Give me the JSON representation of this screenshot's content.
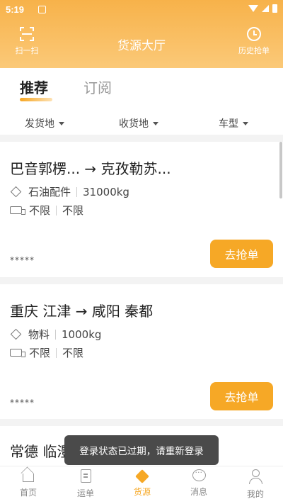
{
  "status_bar": {
    "time": "5:19"
  },
  "header": {
    "title": "货源大厅",
    "scan_label": "扫一扫",
    "history_label": "历史抢单"
  },
  "tabs": [
    {
      "label": "推荐",
      "active": true
    },
    {
      "label": "订阅",
      "active": false
    }
  ],
  "filters": [
    {
      "label": "发货地"
    },
    {
      "label": "收货地"
    },
    {
      "label": "车型"
    }
  ],
  "cards": [
    {
      "route": "巴音郭楞... → 克孜勒苏...",
      "goods": "石油配件",
      "weight": "31000kg",
      "vehicle_length": "不限",
      "vehicle_type": "不限",
      "stars": "*****",
      "button": "去抢单"
    },
    {
      "route": "重庆 江津 → 咸阳 秦都",
      "goods": "物料",
      "weight": "1000kg",
      "vehicle_length": "不限",
      "vehicle_type": "不限",
      "stars": "*****",
      "button": "去抢单"
    },
    {
      "route": "常德 临澧"
    }
  ],
  "toast": "登录状态已过期，请重新登录",
  "bottom_nav": [
    {
      "label": "首页",
      "icon": "home-icon"
    },
    {
      "label": "运单",
      "icon": "document-icon"
    },
    {
      "label": "货源",
      "icon": "box-icon",
      "active": true
    },
    {
      "label": "消息",
      "icon": "message-icon"
    },
    {
      "label": "我的",
      "icon": "user-icon"
    }
  ],
  "colors": {
    "accent": "#f6a826",
    "header_gradient_top": "#f7b24a",
    "toast_bg": "#4a4a4a"
  }
}
